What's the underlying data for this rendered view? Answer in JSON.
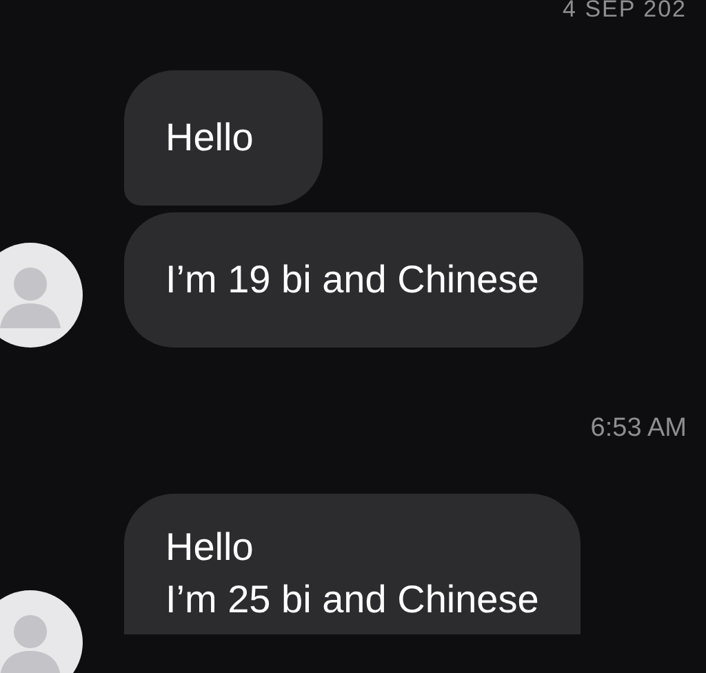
{
  "date_header": "4 SEP 202",
  "groups": [
    {
      "bubbles": [
        {
          "lines": [
            "Hello"
          ]
        },
        {
          "lines": [
            "I’m 19 bi and Chinese"
          ]
        }
      ]
    },
    {
      "time": "6:53 AM",
      "bubbles": [
        {
          "lines": [
            "Hello",
            "I’m 25 bi and Chinese"
          ]
        }
      ]
    }
  ]
}
